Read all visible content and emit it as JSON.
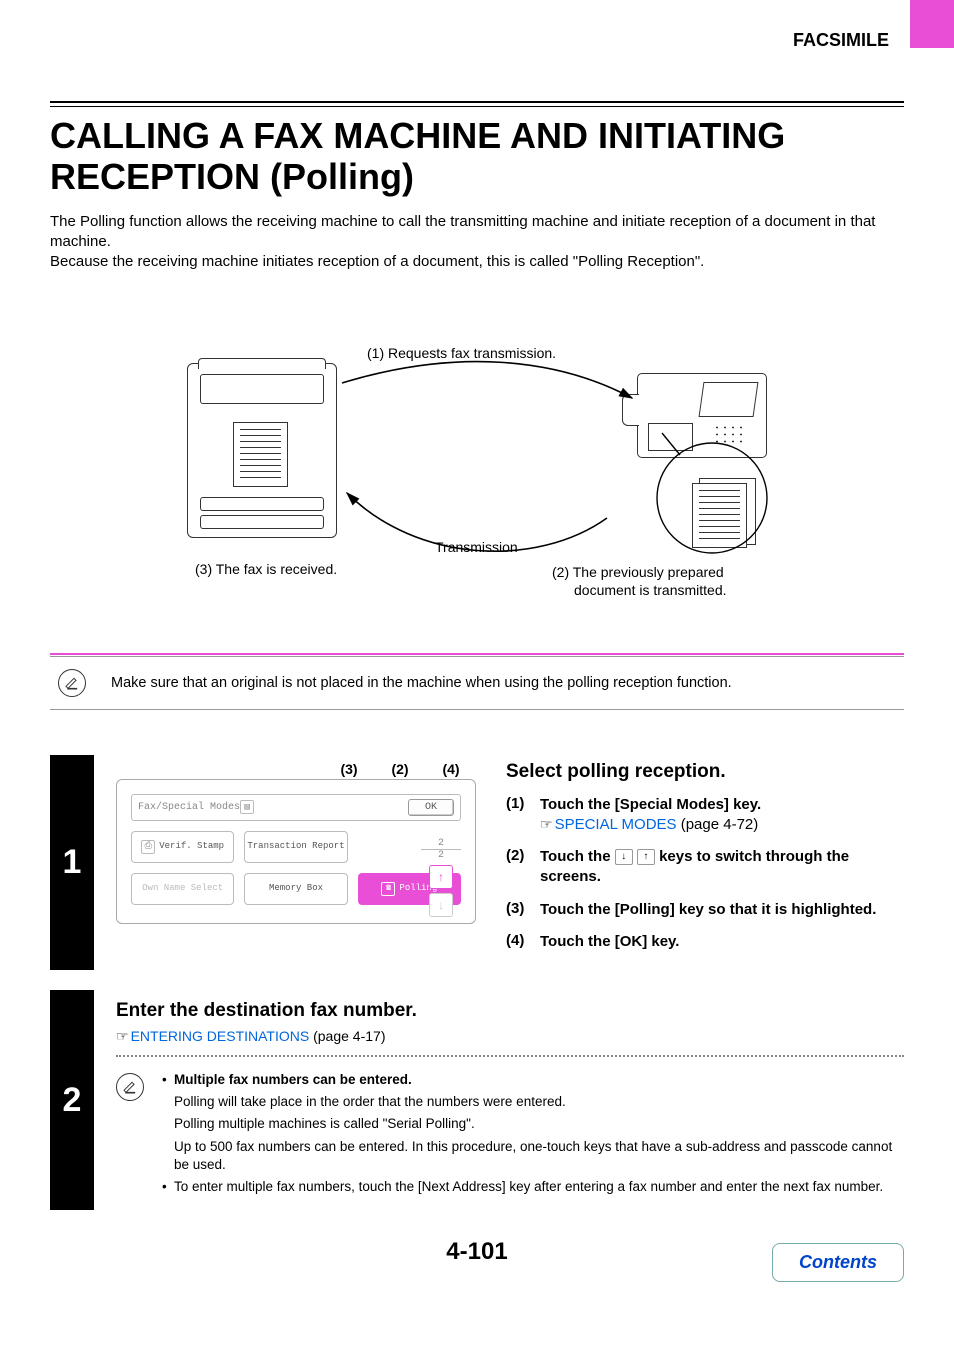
{
  "header": {
    "section": "FACSIMILE"
  },
  "title": "CALLING A FAX MACHINE AND INITIATING RECEPTION (Polling)",
  "intro_p1": "The Polling function allows the receiving machine to call the transmitting machine and initiate reception of a document in that machine.",
  "intro_p2": "Because the receiving machine initiates reception of a document, this is called \"Polling Reception\".",
  "diagram": {
    "l1": "(1) Requests fax transmission.",
    "l2a": "(2) The previously prepared",
    "l2b": "document is transmitted.",
    "l3": "(3) The fax is received.",
    "trans": "Transmission"
  },
  "note1": "Make sure that an original is not placed in the machine when using the polling reception function.",
  "step1": {
    "num": "1",
    "callouts": {
      "a": "(3)",
      "b": "(2)",
      "c": "(4)"
    },
    "lcd": {
      "title": "Fax/Special Modes",
      "ok": "OK",
      "verif": "Verif. Stamp",
      "trans": "Transaction Report",
      "own": "Own Name Select",
      "memory": "Memory Box",
      "polling": "Polling",
      "frac_n": "2",
      "frac_d": "2"
    },
    "heading": "Select polling reception.",
    "items": {
      "i1_lbl": "(1)",
      "i1_txt": "Touch the [Special Modes] key.",
      "i1_link": "SPECIAL MODES",
      "i1_ref": " (page 4-72)",
      "i2_lbl": "(2)",
      "i2_txt_a": "Touch the ",
      "i2_txt_b": " keys to switch through the screens.",
      "i3_lbl": "(3)",
      "i3_txt": "Touch the [Polling] key so that it is highlighted.",
      "i4_lbl": "(4)",
      "i4_txt": "Touch the [OK] key."
    }
  },
  "step2": {
    "num": "2",
    "heading": "Enter the destination fax number.",
    "link": "ENTERING DESTINATIONS",
    "ref": " (page 4-17)",
    "b1_lead": "Multiple fax numbers can be entered.",
    "b1_a": "Polling will take place in the order that the numbers were entered.",
    "b1_b": "Polling multiple machines is called \"Serial Polling\".",
    "b1_c": "Up to 500 fax numbers can be entered. In this procedure, one-touch keys that have a sub-address and passcode cannot be used.",
    "b2": "To enter multiple fax numbers, touch the [Next Address] key after entering a fax number and enter the next fax number."
  },
  "pagenum": "4-101",
  "contents": "Contents"
}
